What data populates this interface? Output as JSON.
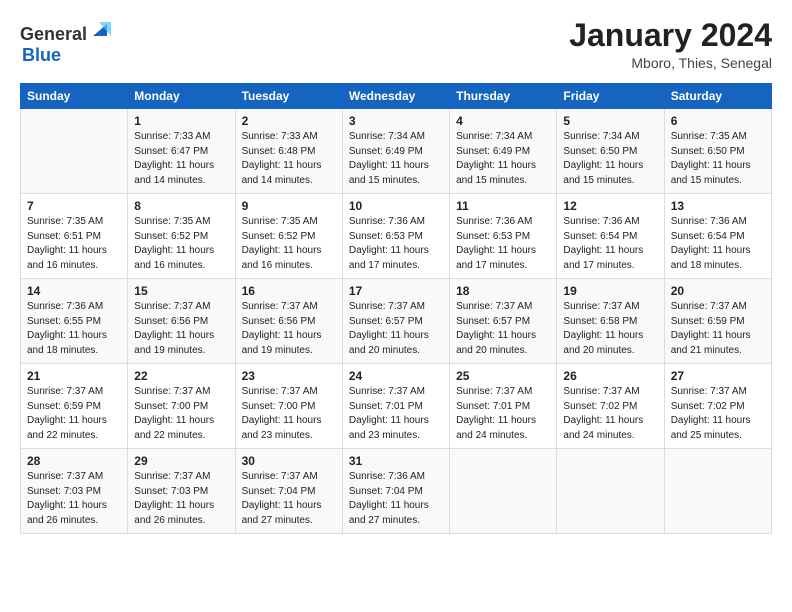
{
  "header": {
    "logo_general": "General",
    "logo_blue": "Blue",
    "month_title": "January 2024",
    "location": "Mboro, Thies, Senegal"
  },
  "days_of_week": [
    "Sunday",
    "Monday",
    "Tuesday",
    "Wednesday",
    "Thursday",
    "Friday",
    "Saturday"
  ],
  "weeks": [
    [
      {
        "num": "",
        "sunrise": "",
        "sunset": "",
        "daylight": ""
      },
      {
        "num": "1",
        "sunrise": "Sunrise: 7:33 AM",
        "sunset": "Sunset: 6:47 PM",
        "daylight": "Daylight: 11 hours and 14 minutes."
      },
      {
        "num": "2",
        "sunrise": "Sunrise: 7:33 AM",
        "sunset": "Sunset: 6:48 PM",
        "daylight": "Daylight: 11 hours and 14 minutes."
      },
      {
        "num": "3",
        "sunrise": "Sunrise: 7:34 AM",
        "sunset": "Sunset: 6:49 PM",
        "daylight": "Daylight: 11 hours and 15 minutes."
      },
      {
        "num": "4",
        "sunrise": "Sunrise: 7:34 AM",
        "sunset": "Sunset: 6:49 PM",
        "daylight": "Daylight: 11 hours and 15 minutes."
      },
      {
        "num": "5",
        "sunrise": "Sunrise: 7:34 AM",
        "sunset": "Sunset: 6:50 PM",
        "daylight": "Daylight: 11 hours and 15 minutes."
      },
      {
        "num": "6",
        "sunrise": "Sunrise: 7:35 AM",
        "sunset": "Sunset: 6:50 PM",
        "daylight": "Daylight: 11 hours and 15 minutes."
      }
    ],
    [
      {
        "num": "7",
        "sunrise": "Sunrise: 7:35 AM",
        "sunset": "Sunset: 6:51 PM",
        "daylight": "Daylight: 11 hours and 16 minutes."
      },
      {
        "num": "8",
        "sunrise": "Sunrise: 7:35 AM",
        "sunset": "Sunset: 6:52 PM",
        "daylight": "Daylight: 11 hours and 16 minutes."
      },
      {
        "num": "9",
        "sunrise": "Sunrise: 7:35 AM",
        "sunset": "Sunset: 6:52 PM",
        "daylight": "Daylight: 11 hours and 16 minutes."
      },
      {
        "num": "10",
        "sunrise": "Sunrise: 7:36 AM",
        "sunset": "Sunset: 6:53 PM",
        "daylight": "Daylight: 11 hours and 17 minutes."
      },
      {
        "num": "11",
        "sunrise": "Sunrise: 7:36 AM",
        "sunset": "Sunset: 6:53 PM",
        "daylight": "Daylight: 11 hours and 17 minutes."
      },
      {
        "num": "12",
        "sunrise": "Sunrise: 7:36 AM",
        "sunset": "Sunset: 6:54 PM",
        "daylight": "Daylight: 11 hours and 17 minutes."
      },
      {
        "num": "13",
        "sunrise": "Sunrise: 7:36 AM",
        "sunset": "Sunset: 6:54 PM",
        "daylight": "Daylight: 11 hours and 18 minutes."
      }
    ],
    [
      {
        "num": "14",
        "sunrise": "Sunrise: 7:36 AM",
        "sunset": "Sunset: 6:55 PM",
        "daylight": "Daylight: 11 hours and 18 minutes."
      },
      {
        "num": "15",
        "sunrise": "Sunrise: 7:37 AM",
        "sunset": "Sunset: 6:56 PM",
        "daylight": "Daylight: 11 hours and 19 minutes."
      },
      {
        "num": "16",
        "sunrise": "Sunrise: 7:37 AM",
        "sunset": "Sunset: 6:56 PM",
        "daylight": "Daylight: 11 hours and 19 minutes."
      },
      {
        "num": "17",
        "sunrise": "Sunrise: 7:37 AM",
        "sunset": "Sunset: 6:57 PM",
        "daylight": "Daylight: 11 hours and 20 minutes."
      },
      {
        "num": "18",
        "sunrise": "Sunrise: 7:37 AM",
        "sunset": "Sunset: 6:57 PM",
        "daylight": "Daylight: 11 hours and 20 minutes."
      },
      {
        "num": "19",
        "sunrise": "Sunrise: 7:37 AM",
        "sunset": "Sunset: 6:58 PM",
        "daylight": "Daylight: 11 hours and 20 minutes."
      },
      {
        "num": "20",
        "sunrise": "Sunrise: 7:37 AM",
        "sunset": "Sunset: 6:59 PM",
        "daylight": "Daylight: 11 hours and 21 minutes."
      }
    ],
    [
      {
        "num": "21",
        "sunrise": "Sunrise: 7:37 AM",
        "sunset": "Sunset: 6:59 PM",
        "daylight": "Daylight: 11 hours and 22 minutes."
      },
      {
        "num": "22",
        "sunrise": "Sunrise: 7:37 AM",
        "sunset": "Sunset: 7:00 PM",
        "daylight": "Daylight: 11 hours and 22 minutes."
      },
      {
        "num": "23",
        "sunrise": "Sunrise: 7:37 AM",
        "sunset": "Sunset: 7:00 PM",
        "daylight": "Daylight: 11 hours and 23 minutes."
      },
      {
        "num": "24",
        "sunrise": "Sunrise: 7:37 AM",
        "sunset": "Sunset: 7:01 PM",
        "daylight": "Daylight: 11 hours and 23 minutes."
      },
      {
        "num": "25",
        "sunrise": "Sunrise: 7:37 AM",
        "sunset": "Sunset: 7:01 PM",
        "daylight": "Daylight: 11 hours and 24 minutes."
      },
      {
        "num": "26",
        "sunrise": "Sunrise: 7:37 AM",
        "sunset": "Sunset: 7:02 PM",
        "daylight": "Daylight: 11 hours and 24 minutes."
      },
      {
        "num": "27",
        "sunrise": "Sunrise: 7:37 AM",
        "sunset": "Sunset: 7:02 PM",
        "daylight": "Daylight: 11 hours and 25 minutes."
      }
    ],
    [
      {
        "num": "28",
        "sunrise": "Sunrise: 7:37 AM",
        "sunset": "Sunset: 7:03 PM",
        "daylight": "Daylight: 11 hours and 26 minutes."
      },
      {
        "num": "29",
        "sunrise": "Sunrise: 7:37 AM",
        "sunset": "Sunset: 7:03 PM",
        "daylight": "Daylight: 11 hours and 26 minutes."
      },
      {
        "num": "30",
        "sunrise": "Sunrise: 7:37 AM",
        "sunset": "Sunset: 7:04 PM",
        "daylight": "Daylight: 11 hours and 27 minutes."
      },
      {
        "num": "31",
        "sunrise": "Sunrise: 7:36 AM",
        "sunset": "Sunset: 7:04 PM",
        "daylight": "Daylight: 11 hours and 27 minutes."
      },
      {
        "num": "",
        "sunrise": "",
        "sunset": "",
        "daylight": ""
      },
      {
        "num": "",
        "sunrise": "",
        "sunset": "",
        "daylight": ""
      },
      {
        "num": "",
        "sunrise": "",
        "sunset": "",
        "daylight": ""
      }
    ]
  ]
}
